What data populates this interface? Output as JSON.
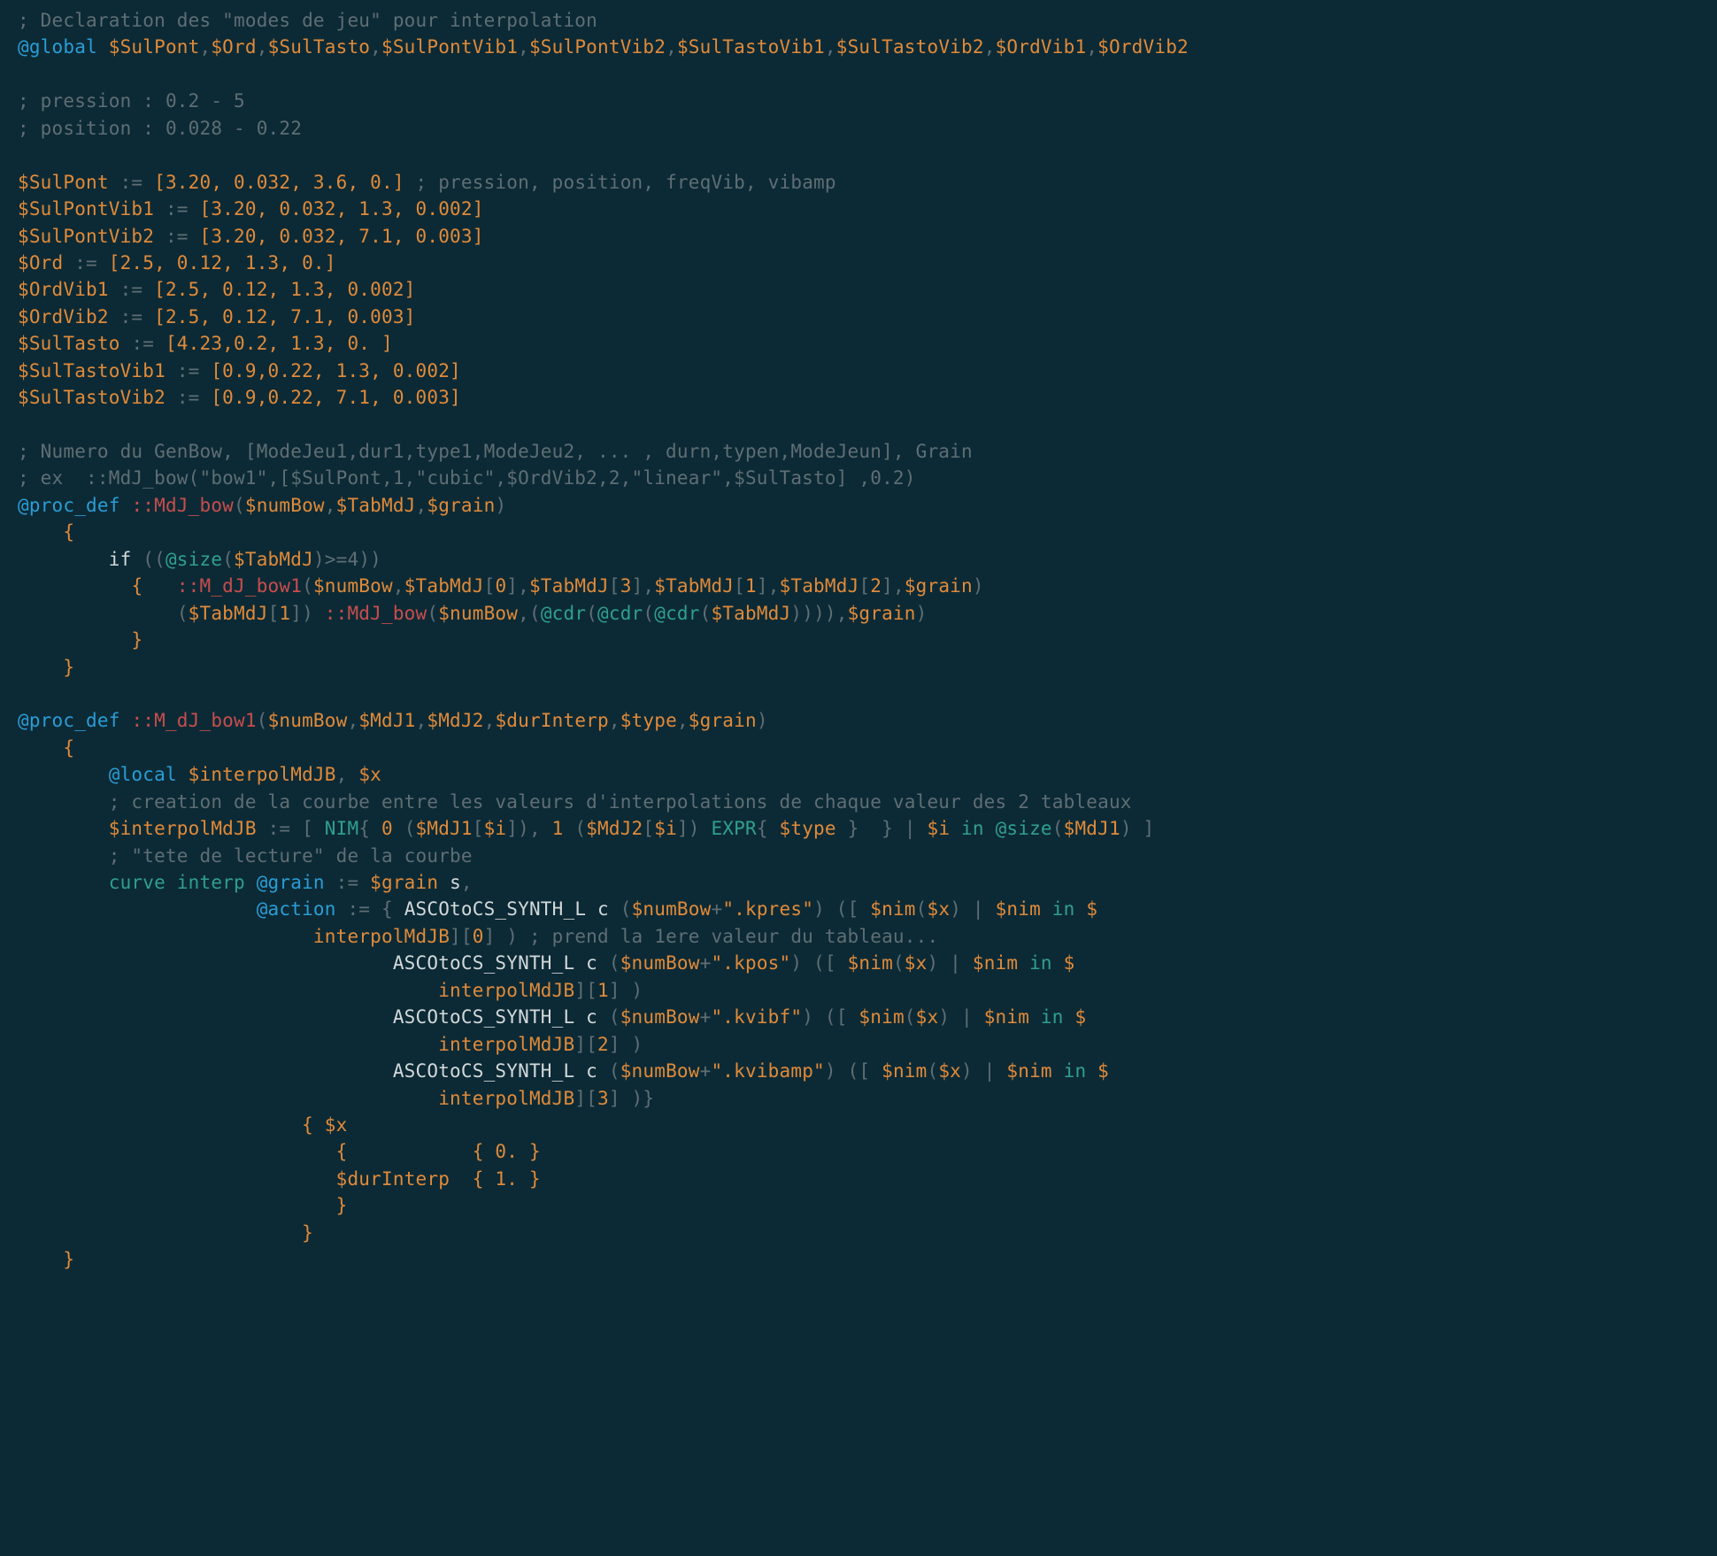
{
  "comments": {
    "c1": "; Declaration des \"modes de jeu\" pour interpolation",
    "c2": "; pression : 0.2 - 5",
    "c3": "; position : 0.028 - 0.22",
    "c4": " ; pression, position, freqVib, vibamp",
    "c5": "; Numero du GenBow, [ModeJeu1,dur1,type1,ModeJeu2, ... , durn,typen,ModeJeun], Grain",
    "c6": "; ex  ::MdJ_bow(\"bow1\",[$SulPont,1,\"cubic\",$OrdVib2,2,\"linear\",$SulTasto] ,0.2)",
    "c7": "; creation de la courbe entre les valeurs d'interpolations de chaque valeur des 2 tableaux",
    "c8": "; \"tete de lecture\" de la courbe",
    "c9": " ; prend la 1ere valeur du tableau..."
  },
  "keywords": {
    "global": "@global",
    "procdef": "@proc_def",
    "local": "@local",
    "grain": "@grain",
    "action": "@action",
    "size": "@size",
    "cdr": "@cdr"
  },
  "ops": {
    "mdj_bow": "::MdJ_bow",
    "m_dj_bow1": "::M_dJ_bow1"
  },
  "ids": {
    "curve": "curve",
    "interp": "interp",
    "nim": "NIM",
    "expr": "EXPR",
    "in": "in",
    "if": "if"
  },
  "fns": {
    "asc": "ASCOtoCS_SYNTH_L",
    "c": "c"
  },
  "vars": {
    "SulPont": "$SulPont",
    "Ord": "$Ord",
    "SulTasto": "$SulTasto",
    "SulPontVib1": "$SulPontVib1",
    "SulPontVib2": "$SulPontVib2",
    "SulTastoVib1": "$SulTastoVib1",
    "SulTastoVib2": "$SulTastoVib2",
    "OrdVib1": "$OrdVib1",
    "OrdVib2": "$OrdVib2",
    "numBow": "$numBow",
    "TabMdJ": "$TabMdJ",
    "grain": "$grain",
    "MdJ1": "$MdJ1",
    "MdJ2": "$MdJ2",
    "durInterp": "$durInterp",
    "type": "$type",
    "interpolMdJB": "$interpolMdJB",
    "x": "$x",
    "nimv": "$nim",
    "i": "$i"
  },
  "arrays": {
    "SulPont": "[3.20, 0.032, 3.6, 0.]",
    "SulPontVib1": "[3.20, 0.032, 1.3, 0.002]",
    "SulPontVib2": "[3.20, 0.032, 7.1, 0.003]",
    "Ord": "[2.5, 0.12, 1.3, 0.]",
    "OrdVib1": "[2.5, 0.12, 1.3, 0.002]",
    "OrdVib2": "[2.5, 0.12, 7.1, 0.003]",
    "SulTasto": "[4.23,0.2, 1.3, 0. ]",
    "SulTastoVib1": "[0.9,0.22, 1.3, 0.002]",
    "SulTastoVib2": "[0.9,0.22, 7.1, 0.003]"
  },
  "strings": {
    "kpres": "\".kpres\"",
    "kpos": "\".kpos\"",
    "kvibf": "\".kvibf\"",
    "kvibamp": "\".kvibamp\""
  },
  "nums": {
    "zero": "0",
    "one": "1",
    "two": "2",
    "three": "3",
    "four": "4",
    "zeroDot": "0.",
    "oneDot": "1."
  },
  "punct": {
    "assign": ":=",
    "comma": ",",
    "lbrace": "{",
    "rbrace": "}",
    "lparen": "(",
    "rparen": ")",
    "lbrack": "[",
    "rbrack": "]",
    "pipe": "|",
    "plus": "+",
    "gte4": ">=4",
    "s": "s"
  }
}
